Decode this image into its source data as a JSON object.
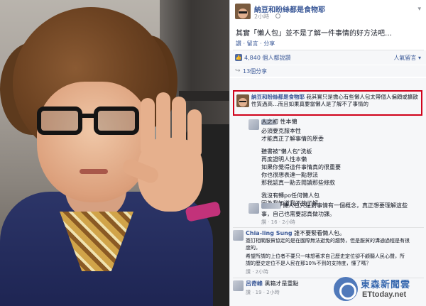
{
  "post": {
    "page_name": "納豆和盼絲都是食物耶",
    "time": "2小時",
    "text": "其實「懶人包」並不是了解一件事情的好方法吧…",
    "actions": "讚 · 留言 · 分享",
    "likes": "4,840 個人都說讚",
    "sort": "人氣留言 ▾",
    "shares": "13個分享"
  },
  "comments": {
    "highlight": {
      "name": "納豆和盼絲都是食物耶",
      "text": "我其實只是擔心有些懶人包太帶個人偏頗或擴散性質過高…而且如果真要當懶人是了解不了事情的"
    },
    "reply1": {
      "lines": [
        "人之初 性本懶",
        "必須要克服本性",
        "才能真正了解事情的原委",
        "",
        "聽書被\"懶人包\"洗板",
        "再度證明人性本懶",
        "如果你覺得這件事情真的很重要",
        "你也很想表達一點想法",
        "那我認真一點去閱讀那些條款",
        "",
        "我沒有轉po任何懶人包",
        "因為我知道我不夠了解"
      ]
    },
    "reply2": {
      "lines": [
        "「懶人包只是對事情有一個概念，真正想要理解這些",
        "事，自己也需要認真做功課。"
      ],
      "meta": "讚 · 16 · 2小時"
    },
    "comment3": {
      "name": "Chia-ling Sung",
      "lead": "誰不要緊看懶人包。",
      "lines": [
        "簽訂相關服貿協定的是在國際無法避免的趨勢，但是服貿的溝通過程是有很",
        "度的。",
        "希望所謂的上位者不要只一味想著求自己歷史定位卻不顧聽人民心聲，所",
        "謂的歷史定位不是人民在那10%不到的支持度，懂了嗎？"
      ],
      "meta": "讚 · 2小時"
    },
    "comment4": {
      "name": "呂奇峰",
      "text": "黑箱才是重點",
      "meta": "讚 · 19 · 2小時"
    }
  },
  "watermark": {
    "brand": "東森新聞雲",
    "url": "ETtoday.net"
  },
  "colors": {
    "link": "#3b5998",
    "highlight_border": "#d0021b",
    "panel_bg": "#f6f7f9"
  }
}
